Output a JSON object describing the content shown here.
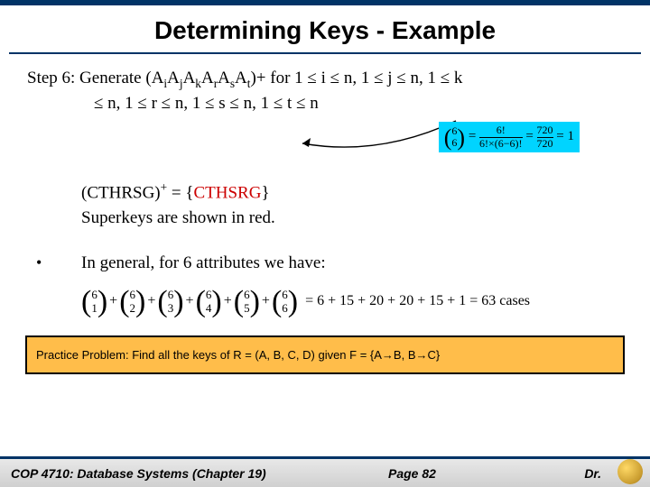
{
  "title": "Determining Keys - Example",
  "step": {
    "label": "Step 6: Generate (A",
    "sub1": "i",
    "mid1": "A",
    "sub2": "j",
    "mid2": "A",
    "sub3": "k",
    "mid3": "A",
    "sub4": "r",
    "mid4": "A",
    "sub5": "s",
    "mid5": "A",
    "sub6": "t",
    "tail": ")+ for 1 ≤ i ≤ n, 1 ≤ j ≤ n, 1 ≤ k",
    "line2": "≤ n, 1 ≤ r ≤ n, 1 ≤ s ≤ n, 1 ≤ t ≤ n"
  },
  "formula": {
    "top": "6",
    "bot": "6",
    "eq": "=",
    "num": "6!",
    "den": "6!×(6−6)!",
    "eq2": "=",
    "num2": "720",
    "den2": "720",
    "res": "= 1"
  },
  "closure": {
    "lhs": "(CTHRSG)",
    "sup": "+",
    "eq": " =  {",
    "rhs": "CTHSRG",
    "close": "}"
  },
  "superkey": "Superkeys are shown in red.",
  "bullet": "In general, for 6 attributes we have:",
  "sum": {
    "b": [
      {
        "n": "6",
        "k": "1"
      },
      {
        "n": "6",
        "k": "2"
      },
      {
        "n": "6",
        "k": "3"
      },
      {
        "n": "6",
        "k": "4"
      },
      {
        "n": "6",
        "k": "5"
      },
      {
        "n": "6",
        "k": "6"
      }
    ],
    "tail": "= 6 + 15 + 20 + 20 + 15 + 1 = 63  cases"
  },
  "practice": "Practice Problem:  Find all the keys of R = (A, B, C, D) given F = {A→B, B→C}",
  "footer": {
    "course": "COP 4710: Database Systems  (Chapter 19)",
    "page": "Page 82",
    "dr": "Dr."
  }
}
